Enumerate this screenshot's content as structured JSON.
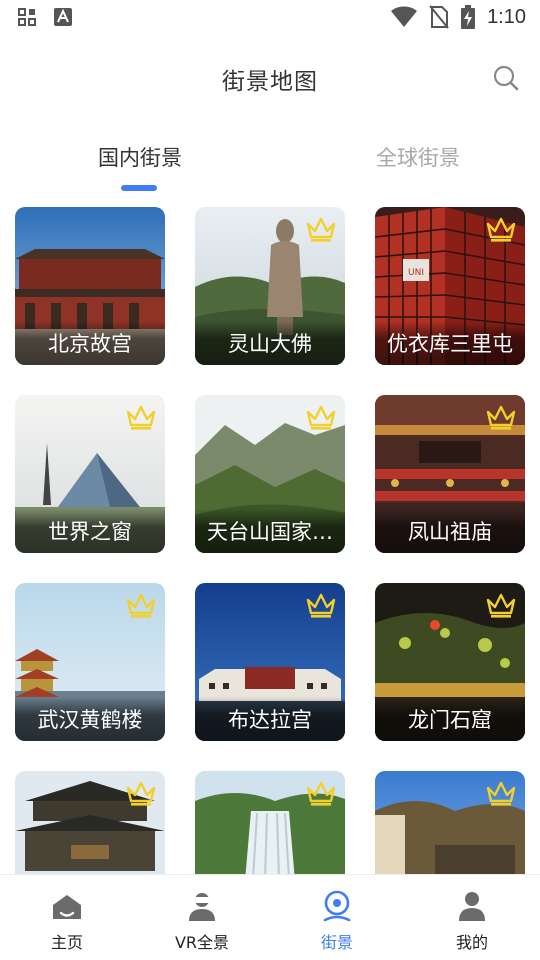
{
  "status_bar": {
    "time": "1:10"
  },
  "header": {
    "title": "街景地图"
  },
  "tabs": [
    {
      "label": "国内街景",
      "active": true
    },
    {
      "label": "全球街景",
      "active": false
    }
  ],
  "places": [
    {
      "name": "北京故宫",
      "premium": false
    },
    {
      "name": "灵山大佛",
      "premium": true
    },
    {
      "name": "优衣库三里屯",
      "premium": true
    },
    {
      "name": "世界之窗",
      "premium": true
    },
    {
      "name": "天台山国家…",
      "premium": true
    },
    {
      "name": "凤山祖庙",
      "premium": true
    },
    {
      "name": "武汉黄鹤楼",
      "premium": true
    },
    {
      "name": "布达拉宫",
      "premium": true
    },
    {
      "name": "龙门石窟",
      "premium": true
    },
    {
      "name": "",
      "premium": true
    },
    {
      "name": "",
      "premium": true
    },
    {
      "name": "",
      "premium": true
    }
  ],
  "bottom_nav": [
    {
      "label": "主页",
      "icon": "home-icon",
      "active": false
    },
    {
      "label": "VR全景",
      "icon": "vr-icon",
      "active": false
    },
    {
      "label": "街景",
      "icon": "street-view-icon",
      "active": true
    },
    {
      "label": "我的",
      "icon": "profile-icon",
      "active": false
    }
  ],
  "colors": {
    "accent": "#3f7cf5",
    "crown": "#f3cf2c",
    "inactive_tab": "#a8a8a8"
  }
}
